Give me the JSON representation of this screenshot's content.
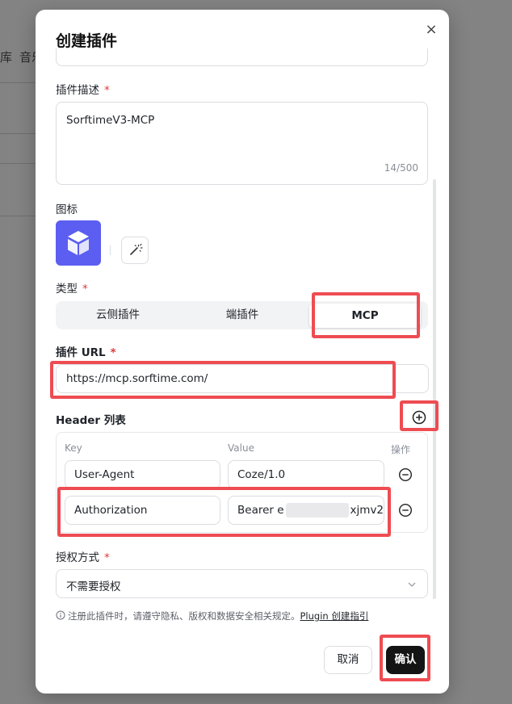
{
  "background": {
    "text_a": "库",
    "text_b": "音乐"
  },
  "dialog": {
    "title": "创建插件",
    "close_glyph": "×"
  },
  "description": {
    "label": "插件描述",
    "required_mark": "*",
    "value": "SorftimeV3-MCP",
    "counter": "14/500"
  },
  "icon_section": {
    "label": "图标",
    "icon_name": "cube-icon",
    "action_icon": "magic-wand-icon"
  },
  "type_section": {
    "label": "类型",
    "required_mark": "*",
    "options": [
      "云侧插件",
      "端插件",
      "MCP"
    ],
    "selected": "MCP"
  },
  "url_section": {
    "label": "插件 URL",
    "required_mark": "*",
    "value": "https://mcp.sorftime.com/"
  },
  "headers": {
    "label": "Header 列表",
    "add_icon": "plus-circle-icon",
    "columns": {
      "key": "Key",
      "value": "Value",
      "action": "操作"
    },
    "rows": [
      {
        "key": "User-Agent",
        "value": "Coze/1.0"
      },
      {
        "key": "Authorization",
        "value_prefix": "Bearer e",
        "value_suffix": "xjmv2"
      }
    ],
    "remove_icon": "minus-circle-icon"
  },
  "auth": {
    "label": "授权方式",
    "required_mark": "*",
    "value": "不需要授权"
  },
  "notice": {
    "icon": "info-icon",
    "text": "注册此插件时，请遵守隐私、版权和数据安全相关规定。",
    "link": "Plugin 创建指引"
  },
  "footer": {
    "cancel_label": "取消",
    "confirm_label": "确认"
  },
  "colors": {
    "highlight": "#ee4c52",
    "icon_tile": "#5b5ef0",
    "confirm": "#141414",
    "required": "#e03838"
  }
}
